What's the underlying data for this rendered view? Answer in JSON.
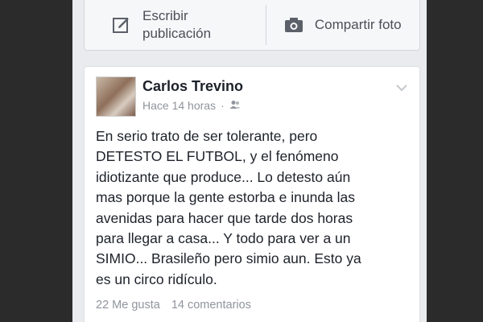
{
  "composer": {
    "write_label": "Escribir\npublicación",
    "photo_label": "Compartir foto"
  },
  "post": {
    "author": "Carlos Trevino",
    "time": "Hace 14 horas",
    "separator": "·",
    "text": "En serio trato de ser tolerante, pero\nDETESTO EL FUTBOL, y el fenómeno\nidiotizante que produce... Lo detesto aún\nmas porque la gente estorba e inunda las\navenidas para hacer que tarde dos horas\npara llegar a casa... Y todo para ver a un\nSIMIO... Brasileño pero simio aun. Esto ya\nes un circo ridículo.",
    "likes": "22 Me gusta",
    "comments": "14 comentarios",
    "audience_icon": "friends-icon"
  },
  "colors": {
    "background": "#2b2b2b",
    "feed": "#e9ebee",
    "text": "#1d2129",
    "meta": "#90949c"
  }
}
